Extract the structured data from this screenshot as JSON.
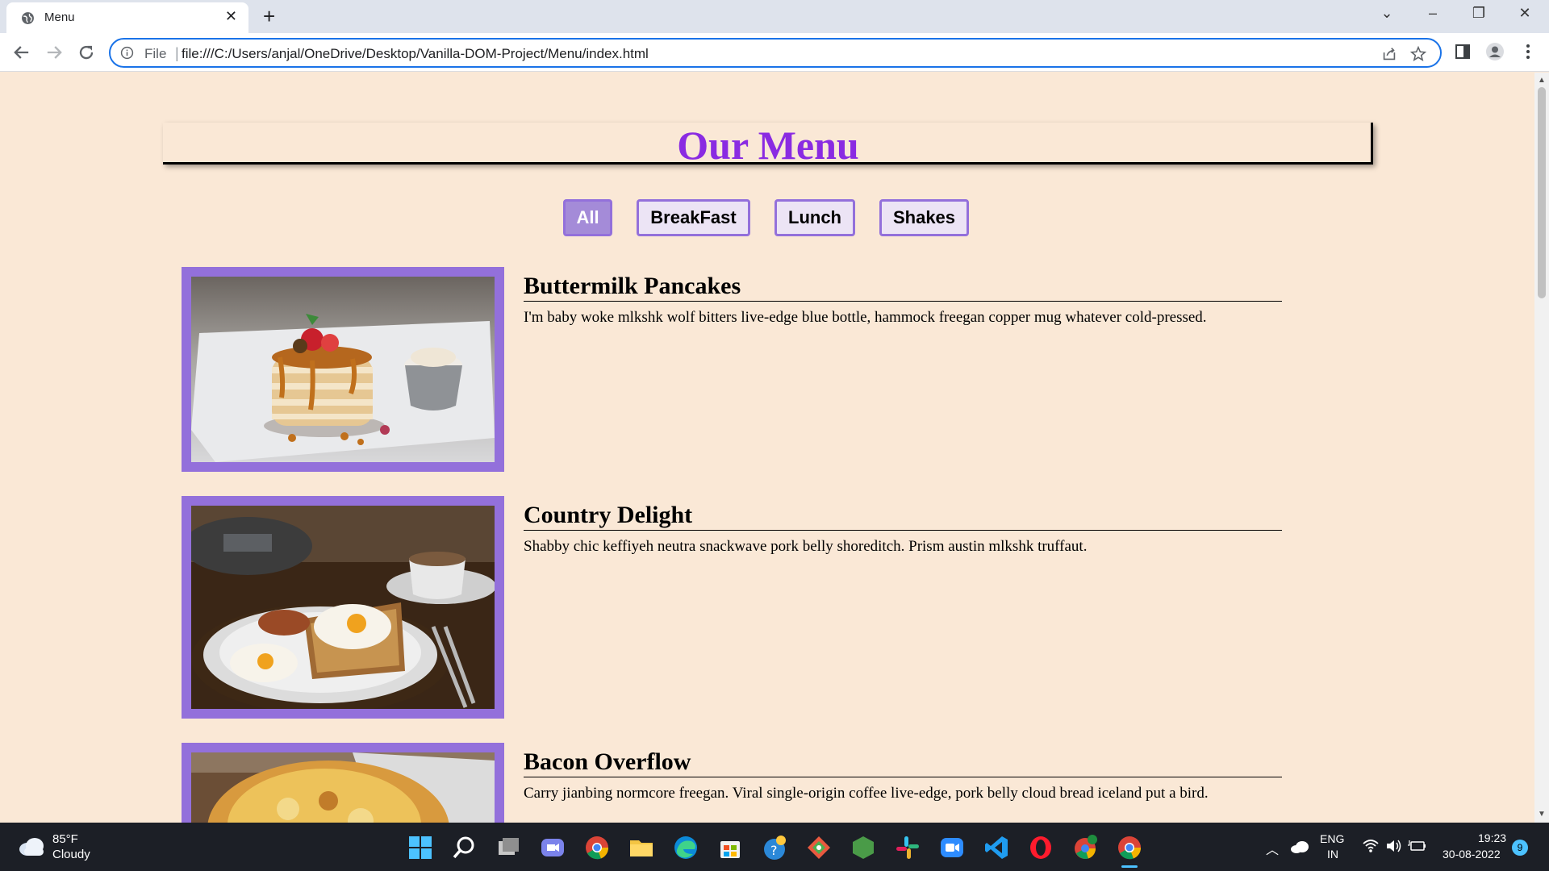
{
  "browser": {
    "tab_title": "Menu",
    "url_scheme_label": "File",
    "url": "file:///C:/Users/anjal/OneDrive/Desktop/Vanilla-DOM-Project/Menu/index.html"
  },
  "page": {
    "title": "Our Menu",
    "title_color": "#8a2be2",
    "accent_color": "#9370db",
    "background_color": "#fae8d6",
    "filters": [
      {
        "label": "All",
        "active": true
      },
      {
        "label": "BreakFast",
        "active": false
      },
      {
        "label": "Lunch",
        "active": false
      },
      {
        "label": "Shakes",
        "active": false
      }
    ],
    "items": [
      {
        "name": "Buttermilk Pancakes",
        "description": "I'm baby woke mlkshk wolf bitters live-edge blue bottle, hammock freegan copper mug whatever cold-pressed.",
        "image": "pancakes-photo"
      },
      {
        "name": "Country Delight",
        "description": "Shabby chic keffiyeh neutra snackwave pork belly shoreditch. Prism austin mlkshk truffaut.",
        "image": "eggs-toast-photo"
      },
      {
        "name": "Bacon Overflow",
        "description": "Carry jianbing normcore freegan. Viral single-origin coffee live-edge, pork belly cloud bread iceland put a bird.",
        "image": "bacon-bake-photo"
      }
    ]
  },
  "taskbar": {
    "weather_temp": "85°F",
    "weather_condition": "Cloudy",
    "language_top": "ENG",
    "language_bottom": "IN",
    "time": "19:23",
    "date": "30-08-2022",
    "notification_count": "9"
  }
}
